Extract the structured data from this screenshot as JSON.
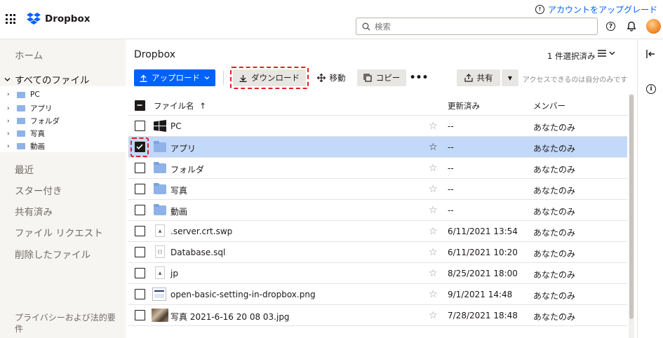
{
  "header": {
    "logo_text": "Dropbox",
    "upgrade_label": "アカウントをアップグレード",
    "search_placeholder": "検索"
  },
  "sidebar": {
    "home": "ホーム",
    "all_files": "すべてのファイル",
    "tree": [
      "PC",
      "アプリ",
      "フォルダ",
      "写真",
      "動画"
    ],
    "recent": "最近",
    "starred": "スター付き",
    "shared": "共有済み",
    "file_requests": "ファイル リクエスト",
    "deleted": "削除したファイル",
    "privacy": "プライバシーおよび法的要件"
  },
  "main": {
    "title": "Dropbox",
    "selection_count": "1 件選択済み",
    "toolbar": {
      "upload": "アップロード",
      "download": "ダウンロード",
      "move": "移動",
      "copy": "コピー",
      "more": "•••",
      "share": "共有",
      "access_note": "アクセスできるのは自分のみです"
    },
    "columns": {
      "name": "ファイル名",
      "modified": "更新済み",
      "members": "メンバー"
    },
    "rows": [
      {
        "name": "PC",
        "modified": "--",
        "members": "あなたのみ"
      },
      {
        "name": "アプリ",
        "modified": "--",
        "members": "あなたのみ"
      },
      {
        "name": "フォルダ",
        "modified": "--",
        "members": "あなたのみ"
      },
      {
        "name": "写真",
        "modified": "--",
        "members": "あなたのみ"
      },
      {
        "name": "動画",
        "modified": "--",
        "members": "あなたのみ"
      },
      {
        "name": ".server.crt.swp",
        "modified": "6/11/2021 13:54",
        "members": "あなたのみ"
      },
      {
        "name": "Database.sql",
        "modified": "6/11/2021 10:20",
        "members": "あなたのみ"
      },
      {
        "name": "jp",
        "modified": "8/25/2021 18:00",
        "members": "あなたのみ"
      },
      {
        "name": "open-basic-setting-in-dropbox.png",
        "modified": "9/1/2021 14:48",
        "members": "あなたのみ"
      },
      {
        "name": "写真 2021-6-16 20 08 03.jpg",
        "modified": "7/28/2021 18:48",
        "members": "あなたのみ"
      }
    ]
  },
  "colors": {
    "accent": "#0061fe",
    "selected_row": "#c3d9fa",
    "highlight": "#e02020"
  }
}
